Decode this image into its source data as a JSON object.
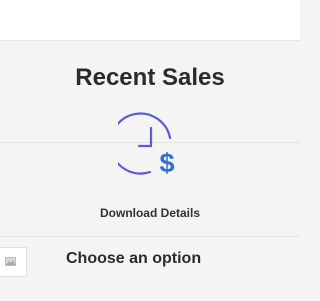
{
  "header": {
    "title": "Recent Sales"
  },
  "action": {
    "icon": "clock-dollar-icon",
    "label": "Download Details",
    "accent_color": "#5b5bd6",
    "dollar_color": "#2f6fd6"
  },
  "options": {
    "icon": "image-placeholder-icon",
    "label": "Choose an option"
  }
}
